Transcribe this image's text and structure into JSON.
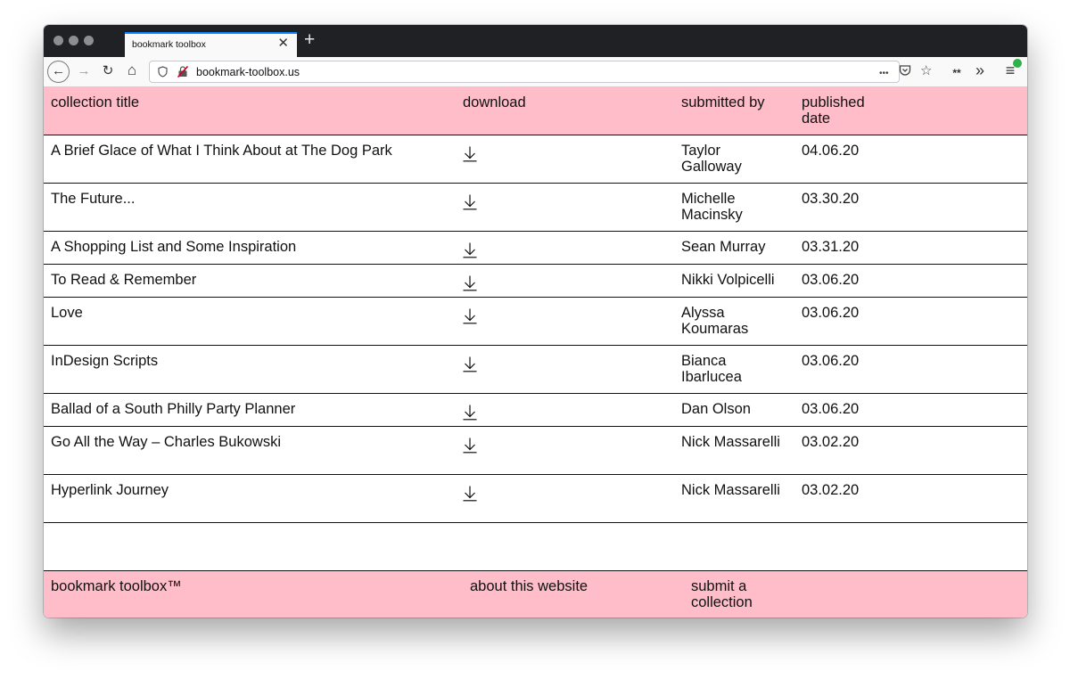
{
  "browser": {
    "tab_title": "bookmark toolbox",
    "tab_close": "✕",
    "new_tab": "+",
    "url": "bookmark-toolbox.us",
    "nav_back": "←",
    "nav_forward": "→",
    "nav_reload": "↻",
    "nav_home": "⌂",
    "url_more": "•••",
    "url_star": "☆",
    "toolbar_ext": "**",
    "toolbar_overflow": "»",
    "toolbar_menu": "≡"
  },
  "table": {
    "headers": {
      "title": "collection title",
      "download": "download",
      "submitted_by": "submitted by",
      "published": "published date"
    },
    "rows": [
      {
        "title": "A Brief Glace of What I Think About at The Dog Park",
        "submitted_by": "Taylor Galloway",
        "date": "04.06.20"
      },
      {
        "title": "The Future...",
        "submitted_by": "Michelle Macinsky",
        "date": "03.30.20"
      },
      {
        "title": "A Shopping List and Some Inspiration",
        "submitted_by": "Sean Murray",
        "date": "03.31.20"
      },
      {
        "title": "To Read & Remember",
        "submitted_by": "Nikki Volpicelli",
        "date": "03.06.20"
      },
      {
        "title": "Love",
        "submitted_by": "Alyssa Koumaras",
        "date": "03.06.20"
      },
      {
        "title": "InDesign Scripts",
        "submitted_by": "Bianca Ibarlucea",
        "date": "03.06.20"
      },
      {
        "title": "Ballad of a South Philly Party Planner",
        "submitted_by": "Dan Olson",
        "date": "03.06.20"
      },
      {
        "title": "Go All the Way – Charles Bukowski",
        "submitted_by": "Nick Massarelli",
        "date": "03.02.20"
      },
      {
        "title": "Hyperlink Journey",
        "submitted_by": "Nick Massarelli",
        "date": "03.02.20"
      }
    ],
    "download_icon": "download-arrow-icon"
  },
  "footer": {
    "brand": "bookmark toolbox™",
    "about": "about this website",
    "submit": "submit a collection"
  },
  "colors": {
    "accent_pink": "#ffbdc9",
    "tab_accent": "#0a84ff"
  }
}
